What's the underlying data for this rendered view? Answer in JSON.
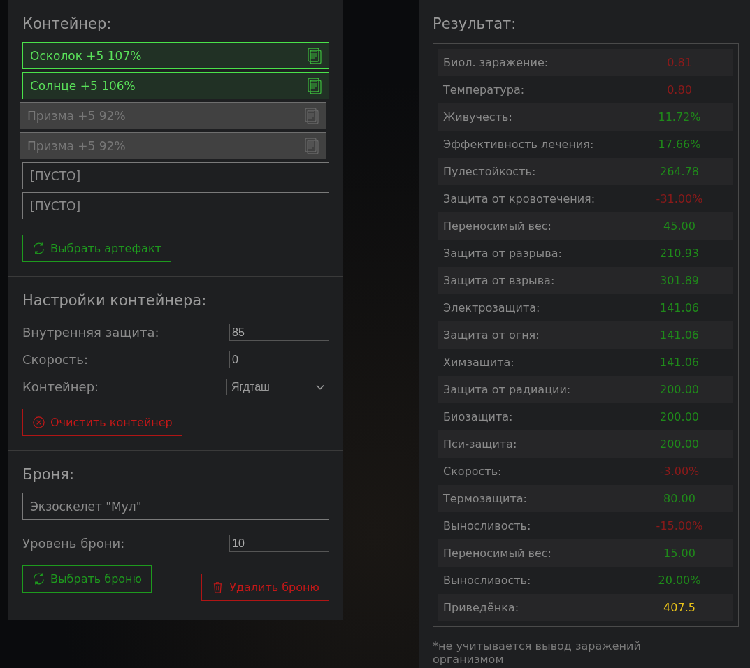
{
  "container": {
    "title": "Контейнер:",
    "slots": [
      {
        "label": "Осколок +5 107%",
        "kind": "active"
      },
      {
        "label": "Солнце +5 106%",
        "kind": "active"
      },
      {
        "label": "Призма +5 92%",
        "kind": "inactive"
      },
      {
        "label": "Призма +5 92%",
        "kind": "inactive"
      },
      {
        "label": "[ПУСТО]",
        "kind": "empty"
      },
      {
        "label": "[ПУСТО]",
        "kind": "empty"
      }
    ],
    "select_button": "Выбрать артефакт"
  },
  "settings": {
    "title": "Настройки контейнера:",
    "fields": [
      {
        "label": "Внутренняя защита:",
        "value": "85",
        "kind": "input"
      },
      {
        "label": "Скорость:",
        "value": "0",
        "kind": "input"
      },
      {
        "label": "Контейнер:",
        "value": "Ягдташ",
        "kind": "select"
      }
    ],
    "clear_button": "Очистить контейнер"
  },
  "armor": {
    "title": "Броня:",
    "name": "Экзоскелет \"Мул\"",
    "level_label": "Уровень брони:",
    "level_value": "10",
    "select_button": "Выбрать броню",
    "delete_button": "Удалить броню"
  },
  "result": {
    "title": "Результат:",
    "rows": [
      {
        "label": "Биол. заражение:",
        "value": "0.81",
        "color": "#8b1a1a"
      },
      {
        "label": "Температура:",
        "value": "0.80",
        "color": "#8b1a1a"
      },
      {
        "label": "Живучесть:",
        "value": "11.72%",
        "color": "#1f8a1a"
      },
      {
        "label": "Эффективность лечения:",
        "value": "17.66%",
        "color": "#1f8a1a"
      },
      {
        "label": "Пулестойкость:",
        "value": "264.78",
        "color": "#1f8a1a"
      },
      {
        "label": "Защита от кровотечения:",
        "value": "-31.00%",
        "color": "#8b1a1a"
      },
      {
        "label": "Переносимый вес:",
        "value": "45.00",
        "color": "#1f8a1a"
      },
      {
        "label": "Защита от разрыва:",
        "value": "210.93",
        "color": "#1f8a1a"
      },
      {
        "label": "Защита от взрыва:",
        "value": "301.89",
        "color": "#1f8a1a"
      },
      {
        "label": "Электрозащита:",
        "value": "141.06",
        "color": "#1f8a1a"
      },
      {
        "label": "Защита от огня:",
        "value": "141.06",
        "color": "#1f8a1a"
      },
      {
        "label": "Химзащита:",
        "value": "141.06",
        "color": "#1f8a1a"
      },
      {
        "label": "Защита от радиации:",
        "value": "200.00",
        "color": "#1f8a1a"
      },
      {
        "label": "Биозащита:",
        "value": "200.00",
        "color": "#1f8a1a"
      },
      {
        "label": "Пси-защита:",
        "value": "200.00",
        "color": "#1f8a1a"
      },
      {
        "label": "Скорость:",
        "value": "-3.00%",
        "color": "#8b1a1a"
      },
      {
        "label": "Термозащита:",
        "value": "80.00",
        "color": "#1f8a1a"
      },
      {
        "label": "Выносливость:",
        "value": "-15.00%",
        "color": "#8b1a1a"
      },
      {
        "label": "Переносимый вес:",
        "value": "15.00",
        "color": "#1f8a1a"
      },
      {
        "label": "Выносливость:",
        "value": "20.00%",
        "color": "#1f8a1a"
      },
      {
        "label": "Приведёнка:",
        "value": "407.5",
        "color": "#e8c21a"
      }
    ],
    "footnote": "*не учитывается вывод заражений организмом"
  }
}
